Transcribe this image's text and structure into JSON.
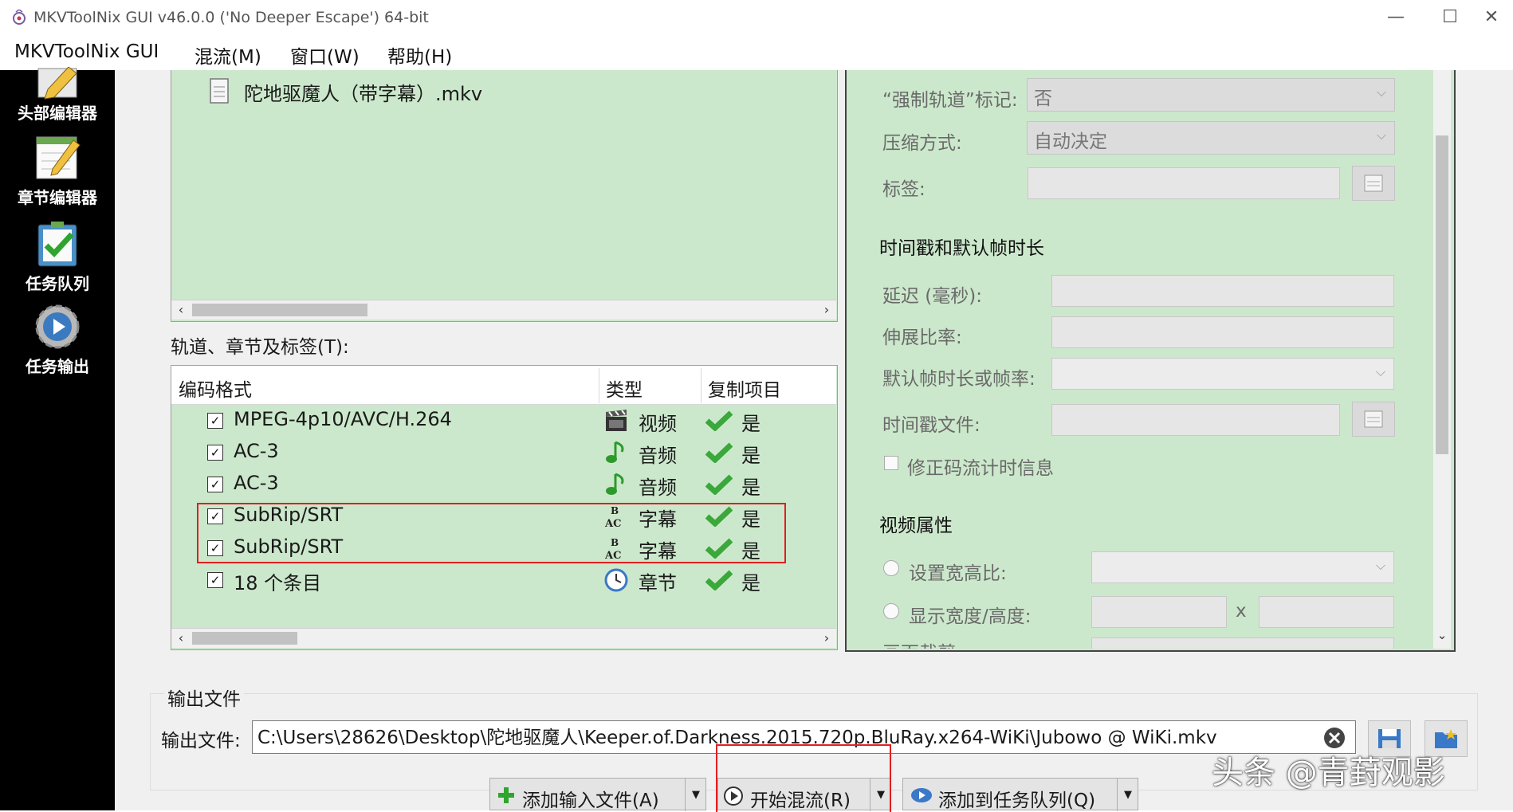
{
  "window": {
    "title": "MKVToolNix GUI v46.0.0 ('No Deeper Escape') 64-bit",
    "minimize": "—",
    "maximize": "☐",
    "close": "✕"
  },
  "menu": [
    "MKVToolNix GUI",
    "混流(M)",
    "窗口(W)",
    "帮助(H)"
  ],
  "sidebar": [
    {
      "label": "头部编辑器",
      "icon": "pencil-icon"
    },
    {
      "label": "章节编辑器",
      "icon": "notepad-icon"
    },
    {
      "label": "任务队列",
      "icon": "clipboard-check-icon"
    },
    {
      "label": "任务输出",
      "icon": "gear-play-icon"
    }
  ],
  "files": {
    "items": [
      "陀地驱魔人（带字幕）.mkv"
    ]
  },
  "tracks": {
    "label": "轨道、章节及标签(T):",
    "headers": [
      "编码格式",
      "类型",
      "复制项目"
    ],
    "rows": [
      {
        "codec": "MPEG-4p10/AVC/H.264",
        "type": "视频",
        "type_icon": "film-icon",
        "copy": "是",
        "checked": "✓"
      },
      {
        "codec": "AC-3",
        "type": "音频",
        "type_icon": "music-note-icon",
        "copy": "是",
        "checked": "✓"
      },
      {
        "codec": "AC-3",
        "type": "音频",
        "type_icon": "music-note-icon",
        "copy": "是",
        "checked": "✓"
      },
      {
        "codec": "SubRip/SRT",
        "type": "字幕",
        "type_icon": "subtitle-icon",
        "copy": "是",
        "checked": "✓"
      },
      {
        "codec": "SubRip/SRT",
        "type": "字幕",
        "type_icon": "subtitle-icon",
        "copy": "是",
        "checked": "✓"
      },
      {
        "codec": "18 个条目",
        "type": "章节",
        "type_icon": "clock-icon",
        "copy": "是",
        "checked": "✓"
      }
    ]
  },
  "properties": {
    "forced_label": "“强制轨道”标记:",
    "forced_value": "否",
    "compression_label": "压缩方式:",
    "compression_value": "自动决定",
    "tags_label": "标签:",
    "timestamps_heading": "时间戳和默认帧时长",
    "delay_label": "延迟 (毫秒):",
    "stretch_label": "伸展比率:",
    "default_duration_label": "默认帧时长或帧率:",
    "timestamp_file_label": "时间戳文件:",
    "fix_bitstream_label": "修正码流计时信息",
    "video_heading": "视频属性",
    "aspect_label": "设置宽高比:",
    "display_label": "显示宽度/高度:",
    "x_sep": "x",
    "cropping_label": "画面裁剪:"
  },
  "output": {
    "group_title": "输出文件",
    "label": "输出文件:",
    "value": "C:\\Users\\28626\\Desktop\\陀地驱魔人\\Keeper.of.Darkness.2015.720p.BluRay.x264-WiKi\\Jubowo @ WiKi.mkv"
  },
  "buttons": {
    "add_input": "添加输入文件(A)",
    "start_mux": "开始混流(R)",
    "add_queue": "添加到任务队列(Q)",
    "dropdown": "▼"
  },
  "watermark": "头条 @青葑观影",
  "colors": {
    "panel_green": "#cce8cc",
    "highlight_red": "#e02020",
    "sidebar_bg": "#000000"
  }
}
